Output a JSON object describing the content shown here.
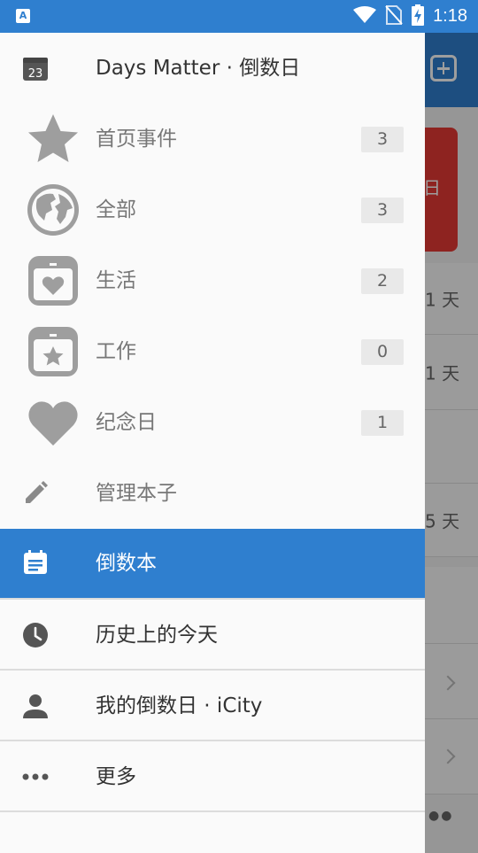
{
  "status_bar": {
    "app_icon": "A",
    "time": "1:18",
    "icons": [
      "wifi-icon",
      "no-sim-icon",
      "battery-charging-icon"
    ]
  },
  "drawer": {
    "header": {
      "calendar_day": "23",
      "title": "Days Matter · 倒数日"
    },
    "books": [
      {
        "label": "首页事件",
        "count": "3",
        "icon": "star-icon"
      },
      {
        "label": "全部",
        "count": "3",
        "icon": "globe-icon"
      },
      {
        "label": "生活",
        "count": "2",
        "icon": "heart-calendar-icon"
      },
      {
        "label": "工作",
        "count": "0",
        "icon": "star-calendar-icon"
      },
      {
        "label": "纪念日",
        "count": "1",
        "icon": "heart-icon"
      }
    ],
    "manage_label": "管理本子",
    "countdown_book_label": "倒数本",
    "history_today_label": "历史上的今天",
    "icity_label": "我的倒数日 · iCity",
    "more_label": "更多"
  },
  "background_app": {
    "card_label": "日",
    "rows": [
      "1 天",
      "1 天",
      "",
      "5 天"
    ]
  },
  "colors": {
    "primary": "#2f7fcf",
    "drawer_bg": "#fafafa",
    "icon_grey": "#9e9e9e",
    "dark_icon": "#555555",
    "badge_bg": "#e9e9e9",
    "card_red": "#e53935"
  }
}
